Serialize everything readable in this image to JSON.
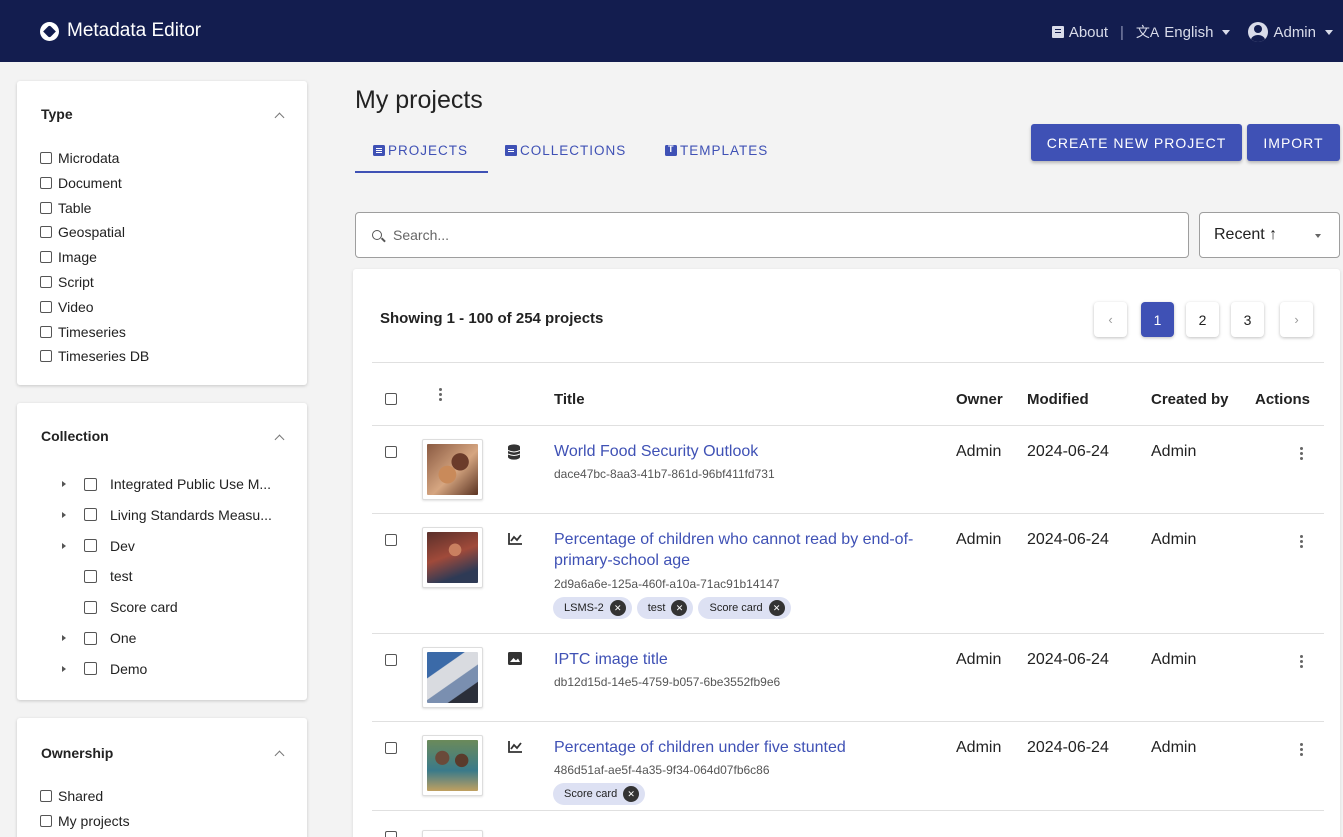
{
  "app": {
    "title": "Metadata Editor"
  },
  "topnav": {
    "about": "About",
    "separator": "|",
    "language": "English",
    "user": "Admin"
  },
  "filters": {
    "type": {
      "title": "Type",
      "items": [
        "Microdata",
        "Document",
        "Table",
        "Geospatial",
        "Image",
        "Script",
        "Video",
        "Timeseries",
        "Timeseries DB"
      ]
    },
    "collection": {
      "title": "Collection",
      "items": [
        {
          "label": "Integrated Public Use M...",
          "expandable": true
        },
        {
          "label": "Living Standards Measu...",
          "expandable": true
        },
        {
          "label": "Dev",
          "expandable": true
        },
        {
          "label": "test",
          "expandable": false
        },
        {
          "label": "Score card",
          "expandable": false
        },
        {
          "label": "One",
          "expandable": true
        },
        {
          "label": "Demo",
          "expandable": true
        }
      ]
    },
    "ownership": {
      "title": "Ownership",
      "items": [
        "Shared",
        "My projects"
      ]
    }
  },
  "main": {
    "title": "My projects",
    "tabs": [
      {
        "label": "PROJECTS",
        "icon": "list-icon",
        "active": true
      },
      {
        "label": "COLLECTIONS",
        "icon": "folder-icon",
        "active": false
      },
      {
        "label": "TEMPLATES",
        "icon": "template-icon",
        "active": false
      }
    ],
    "buttons": {
      "create": "CREATE NEW PROJECT",
      "import": "IMPORT"
    },
    "search": {
      "placeholder": "Search..."
    },
    "sort": {
      "label": "Recent ↑"
    },
    "showing": "Showing 1 - 100 of 254 projects",
    "pagination": {
      "pages": [
        "1",
        "2",
        "3"
      ],
      "current": "1",
      "prev": "‹",
      "next": "›"
    }
  },
  "table": {
    "columns": {
      "title": "Title",
      "owner": "Owner",
      "modified": "Modified",
      "created_by": "Created by",
      "actions": "Actions"
    },
    "rows": [
      {
        "title_line1": "World Food Security Outlook",
        "title_line2": "",
        "id": "dace47bc-8aa3-41b7-861d-96bf411fd731",
        "type_icon": "database-icon",
        "owner": "Admin",
        "modified": "2024-06-24",
        "created_by": "Admin",
        "tags": []
      },
      {
        "title_line1": "Percentage of children who cannot read by end-of-",
        "title_line2": "primary-school age",
        "id": "2d9a6a6e-125a-460f-a10a-71ac91b14147",
        "type_icon": "timeseries-icon",
        "owner": "Admin",
        "modified": "2024-06-24",
        "created_by": "Admin",
        "tags": [
          "LSMS-2",
          "test",
          "Score card"
        ]
      },
      {
        "title_line1": "IPTC image title",
        "title_line2": "",
        "id": "db12d15d-14e5-4759-b057-6be3552fb9e6",
        "type_icon": "image-icon",
        "owner": "Admin",
        "modified": "2024-06-24",
        "created_by": "Admin",
        "tags": []
      },
      {
        "title_line1": "Percentage of children under five stunted",
        "title_line2": "",
        "id": "486d51af-ae5f-4a35-9f34-064d07fb6c86",
        "type_icon": "timeseries-icon",
        "owner": "Admin",
        "modified": "2024-06-24",
        "created_by": "Admin",
        "tags": [
          "Score card"
        ]
      }
    ]
  },
  "colors": {
    "navbar": "#131d4f",
    "accent": "#3f51b5",
    "chip": "#dde1f3"
  }
}
